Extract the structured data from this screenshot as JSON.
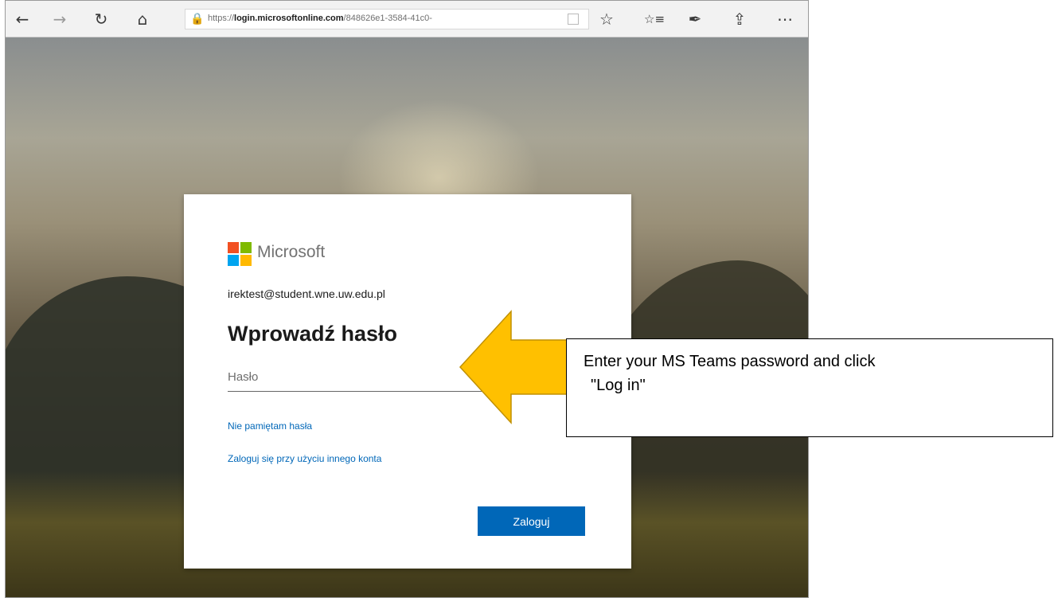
{
  "browser": {
    "url_prefix": "https://",
    "url_host": "login.microsoftonline.com",
    "url_path": "/848626e1-3584-41c0-",
    "icons": {
      "back": "←",
      "forward": "→",
      "refresh": "↻",
      "home": "⌂",
      "lock": "🔒",
      "favorite": "☆",
      "favorites_bar": "☆≡",
      "notes": "✒",
      "share": "⇪",
      "more": "⋯"
    }
  },
  "login": {
    "brand": "Microsoft",
    "email": "irektest@student.wne.uw.edu.pl",
    "heading": "Wprowadź hasło",
    "password_placeholder": "Hasło",
    "forgot_link": "Nie pamiętam hasła",
    "other_account_link": "Zaloguj się przy użyciu innego konta",
    "submit_label": "Zaloguj"
  },
  "annotation": {
    "line1": "Enter your MS Teams password and click",
    "line2": "\"Log in\"",
    "arrow_color": "#ffc000",
    "arrow_border": "#c09000"
  }
}
